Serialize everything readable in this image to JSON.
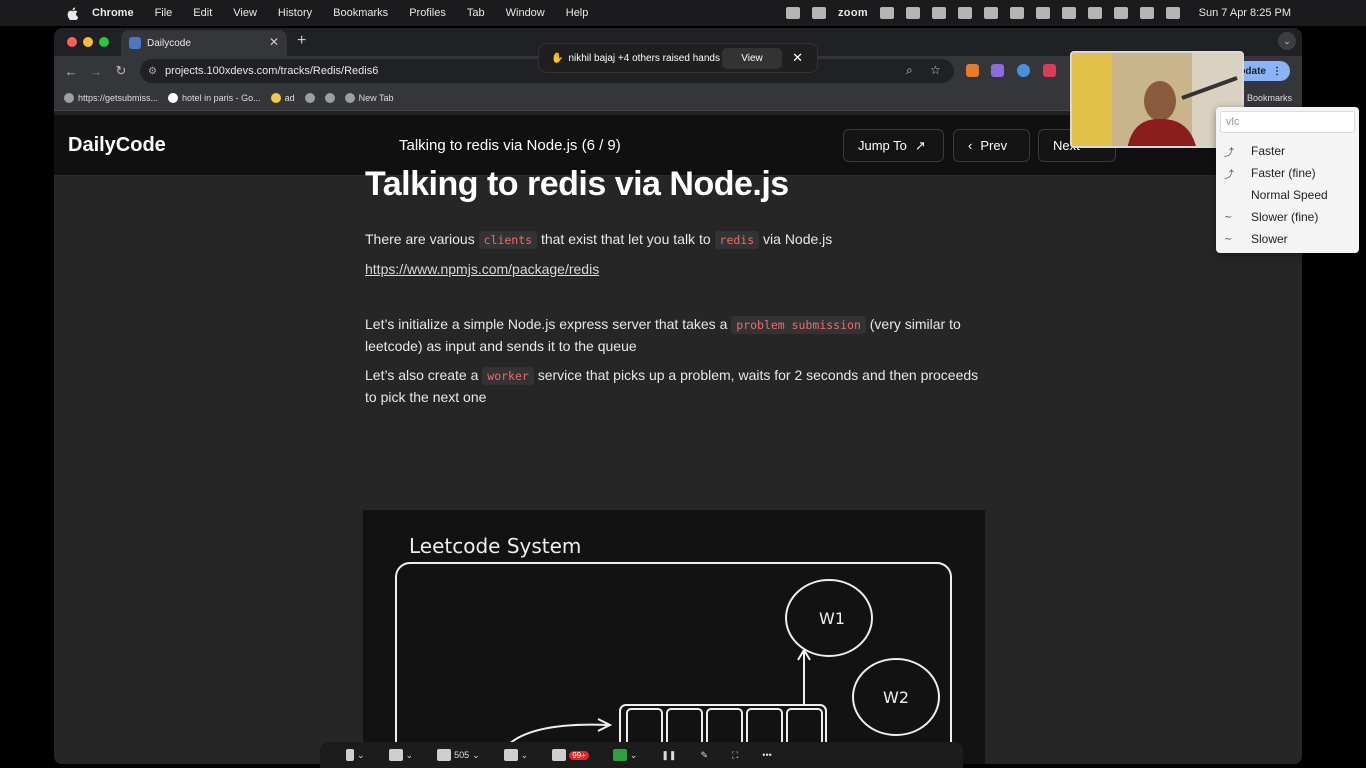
{
  "menubar": {
    "app": "Chrome",
    "items": [
      "File",
      "Edit",
      "View",
      "History",
      "Bookmarks",
      "Profiles",
      "Tab",
      "Window",
      "Help"
    ],
    "zoom_label": "zoom",
    "clock": "Sun 7 Apr  8:25 PM"
  },
  "browser": {
    "tab_title": "Dailycode",
    "url": "projects.100xdevs.com/tracks/Redis/Redis6",
    "update_label": "update",
    "bookmarks": [
      "https://getsubmiss...",
      "hotel in paris - Go...",
      "ad",
      "",
      "",
      "New Tab"
    ],
    "all_bookmarks": "Bookmarks"
  },
  "zoom_popup": {
    "message": "nikhil bajaj +4 others raised hands",
    "view_label": "View"
  },
  "vlc": {
    "search_placeholder": "vlc",
    "items": [
      "Faster",
      "Faster (fine)",
      "Normal Speed",
      "Slower (fine)",
      "Slower"
    ]
  },
  "site": {
    "brand": "DailyCode",
    "lesson_title": "Talking to redis via Node.js (6 / 9)",
    "jump_label": "Jump To",
    "prev_label": "Prev",
    "next_label": "Next"
  },
  "article": {
    "heading": "Talking to redis via Node.js",
    "p1_a": "There are various ",
    "p1_code1": "clients",
    "p1_b": " that exist that let you talk to ",
    "p1_code2": "redis",
    "p1_c": " via Node.js",
    "link": "https://www.npmjs.com/package/redis",
    "p2_a": "Let’s initialize a simple Node.js express server that takes a ",
    "p2_code": "problem submission",
    "p2_b": " (very similar to leetcode) as input and sends it to the queue",
    "p3_a": "Let’s also create a ",
    "p3_code": "worker",
    "p3_b": " service that picks up a problem, waits for 2 seconds and then proceeds to pick the next one"
  },
  "diagram": {
    "title": "Leetcode System",
    "w1": "W1",
    "w2": "W2"
  },
  "zoom_toolbar": {
    "participants": "505",
    "chat_badge": "99+"
  }
}
